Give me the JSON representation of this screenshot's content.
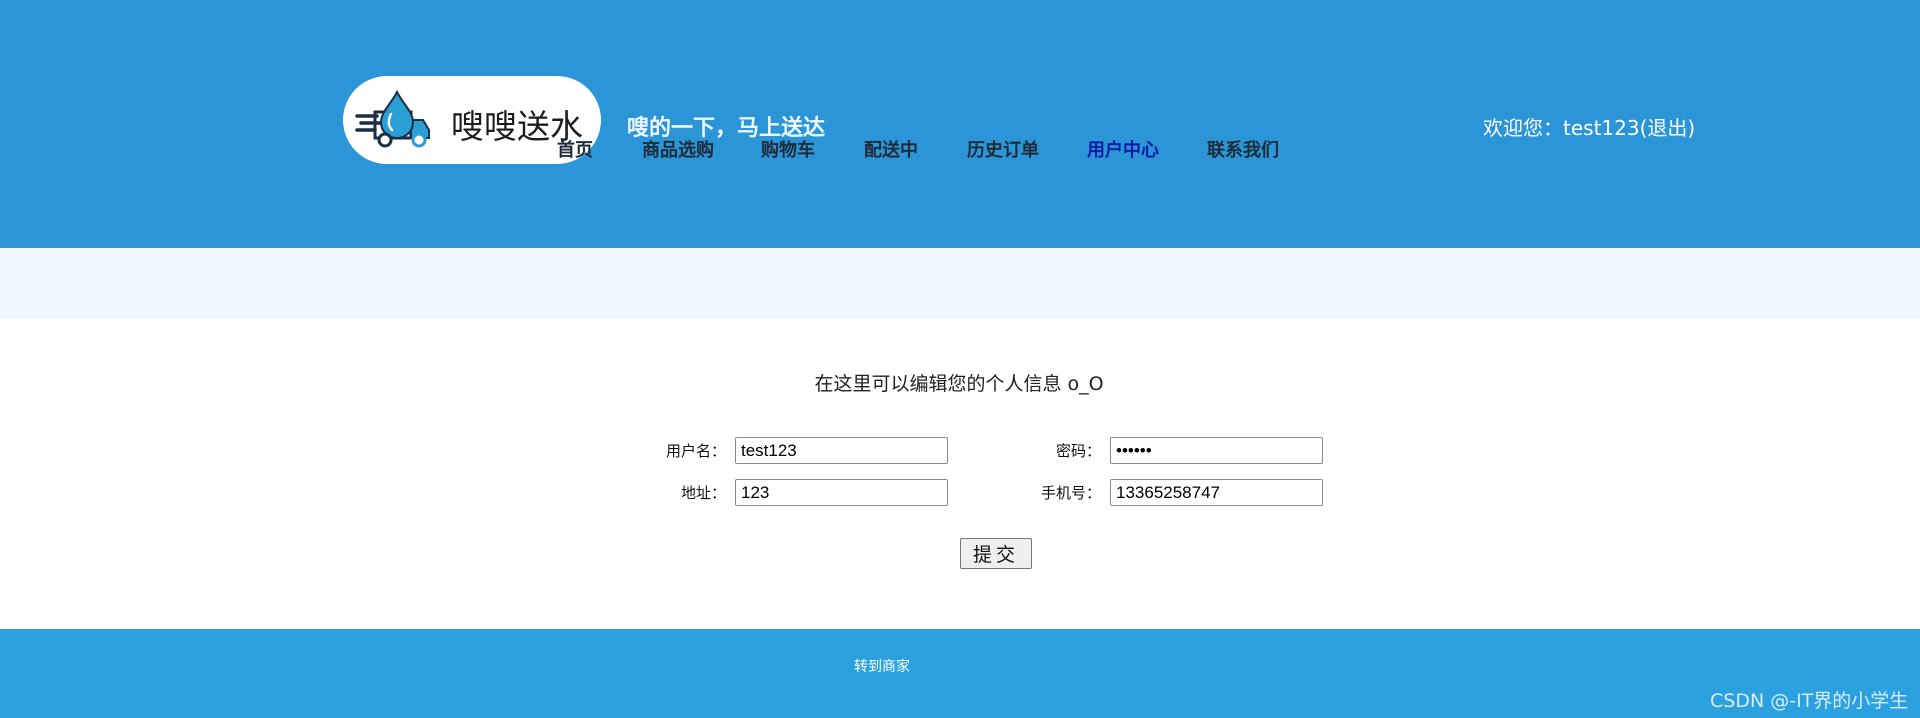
{
  "header": {
    "brand_name": "嗖嗖送水",
    "slogan": "嗖的一下，马上送达",
    "nav": [
      "首页",
      "商品选购",
      "购物车",
      "配送中",
      "历史订单",
      "用户中心",
      "联系我们"
    ],
    "active_nav": "用户中心",
    "welcome_prefix": "欢迎您：",
    "username": "test123",
    "logout_label": "(退出)"
  },
  "form": {
    "intro": "在这里可以编辑您的个人信息 o_O",
    "username_label": "用户名：",
    "username_value": "test123",
    "password_label": "密码：",
    "password_value": "123456",
    "address_label": "地址：",
    "address_value": "123",
    "phone_label": "手机号：",
    "phone_value": "13365258747",
    "submit_label": "提交"
  },
  "footer": {
    "merchant_link": "转到商家",
    "watermark": "CSDN @-IT界的小学生"
  },
  "colors": {
    "header_bg": "#2b95d7",
    "band_bg": "#eef8fe",
    "footer_bg": "#2ba1e0",
    "active_nav": "#0d1aa8"
  },
  "icons": {
    "logo": "delivery-truck-water-drop-icon"
  }
}
